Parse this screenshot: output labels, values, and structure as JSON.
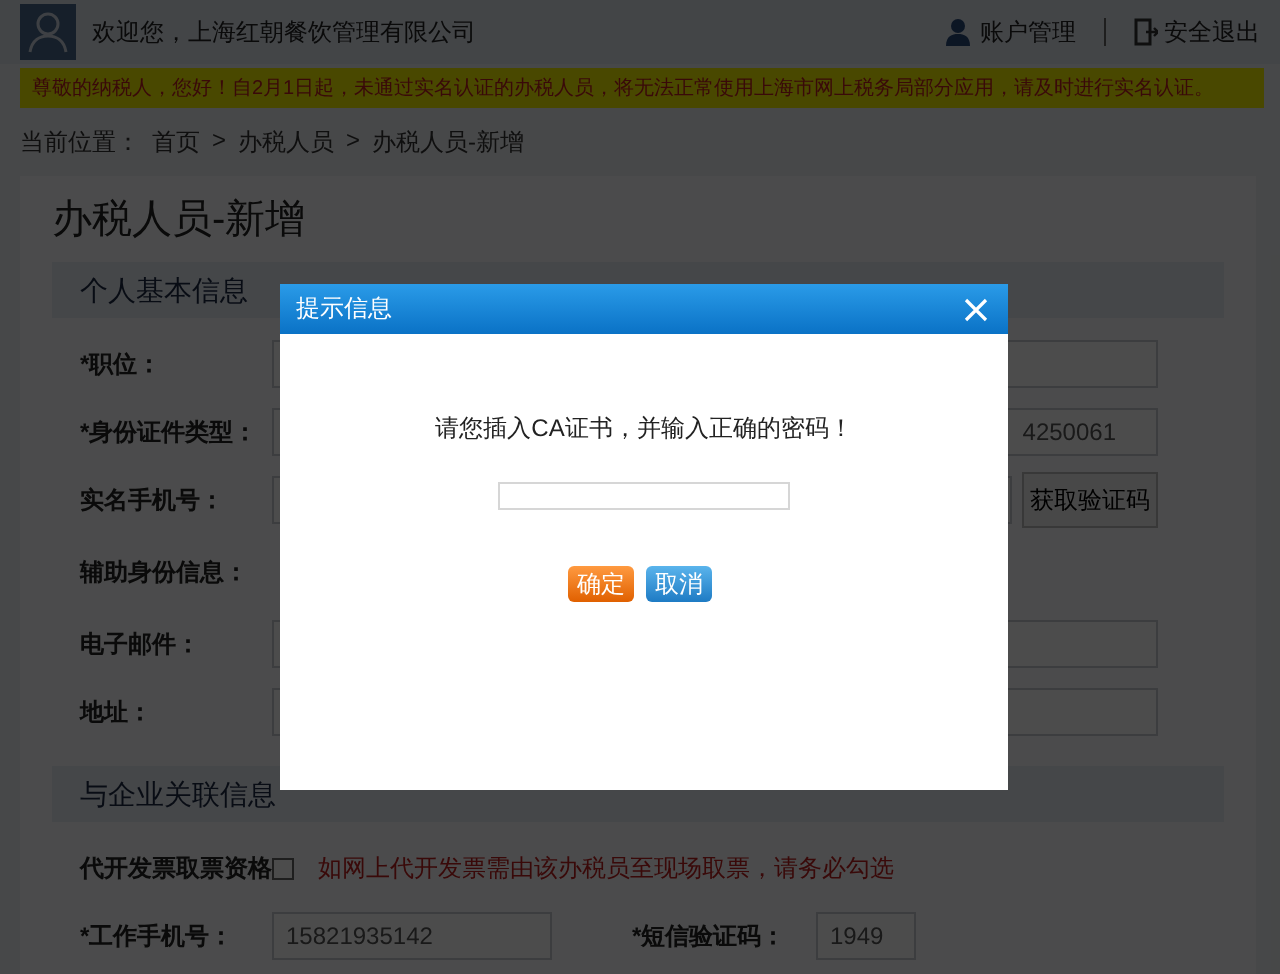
{
  "header": {
    "welcome": "欢迎您，上海红朝餐饮管理有限公司",
    "links": [
      {
        "label": "账户管理",
        "kind": "account"
      },
      {
        "label": "安全退出",
        "kind": "logout"
      }
    ]
  },
  "notice": "尊敬的纳税人，您好！自2月1日起，未通过实名认证的办税人员，将无法正常使用上海市网上税务局部分应用，请及时进行实名认证。",
  "breadcrumb": {
    "prefix": "当前位置：",
    "items": [
      "首页",
      "办税人员",
      "办税人员-新增"
    ],
    "separator": ">"
  },
  "page_title": "办税人员-新增",
  "sections": [
    {
      "title": "个人基本信息",
      "rows": [
        {
          "kind": "input",
          "label": "*职位："
        },
        {
          "kind": "input",
          "label": "*身份证件类型：",
          "value": "4250061"
        },
        {
          "kind": "input_button",
          "label": "实名手机号：",
          "button": "获取验证码"
        },
        {
          "kind": "text",
          "label": "辅助身份信息："
        },
        {
          "kind": "input",
          "label": "电子邮件："
        },
        {
          "kind": "input",
          "label": "地址："
        }
      ]
    },
    {
      "title": "与企业关联信息",
      "rows": [
        {
          "kind": "checkbox",
          "label": "代开发票取票资格",
          "checked": false,
          "note": "如网上代开发票需由该办税员至现场取票，请务必勾选"
        },
        {
          "kind": "pair",
          "label": "*工作手机号：",
          "value": "15821935142",
          "label2": "*短信验证码：",
          "value2": "1949"
        }
      ]
    }
  ],
  "dialog": {
    "title": "提示信息",
    "message": "请您插入CA证书，并输入正确的密码！",
    "buttons": [
      {
        "label": "确定",
        "kind": "primary"
      },
      {
        "label": "取消",
        "kind": "secondary"
      }
    ]
  }
}
